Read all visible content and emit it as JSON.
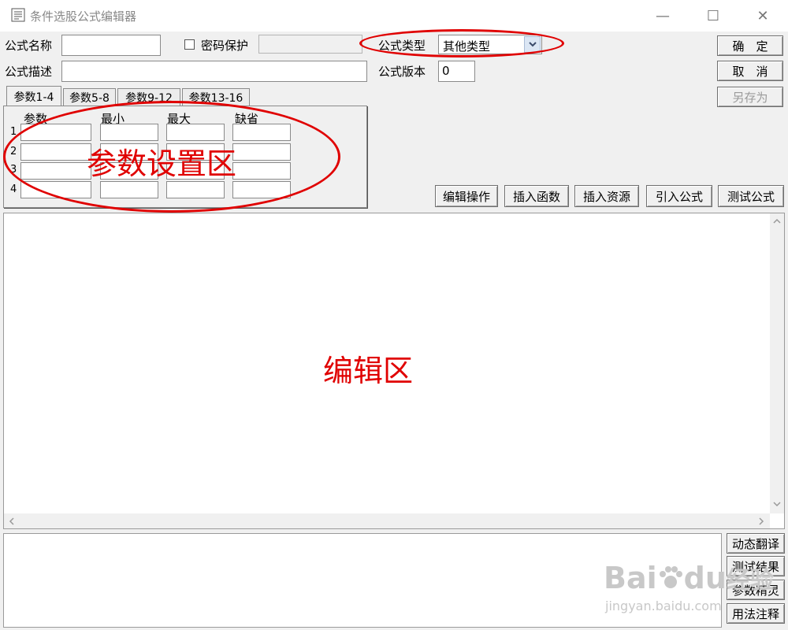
{
  "window": {
    "title": "条件选股公式编辑器",
    "controls": [
      "—",
      "☐",
      "✕"
    ]
  },
  "form": {
    "name_label": "公式名称",
    "name_value": "",
    "password_label": "密码保护",
    "password_checked": false,
    "password_value": "",
    "type_label": "公式类型",
    "type_value": "其他类型",
    "desc_label": "公式描述",
    "desc_value": "",
    "version_label": "公式版本",
    "version_value": "0"
  },
  "actions": {
    "ok": "确　定",
    "cancel": "取　消",
    "save_as": "另存为"
  },
  "tabs": [
    "参数1-4",
    "参数5-8",
    "参数9-12",
    "参数13-16"
  ],
  "params": {
    "headers": [
      "参数",
      "最小",
      "最大",
      "缺省"
    ],
    "rows": [
      "1",
      "2",
      "3",
      "4"
    ]
  },
  "toolbar": [
    "编辑操作",
    "插入函数",
    "插入资源",
    "引入公式",
    "测试公式"
  ],
  "side_buttons": [
    "动态翻译",
    "测试结果",
    "参数精灵",
    "用法注释"
  ],
  "annotations": {
    "param_area": "参数设置区",
    "edit_area": "编辑区"
  },
  "watermark": {
    "brand_a": "Bai",
    "brand_b": "du",
    "brand_c": "经验",
    "url": "jingyan.baidu.com"
  },
  "colors": {
    "annotation": "#e00000",
    "background": "#f0f0f0"
  }
}
